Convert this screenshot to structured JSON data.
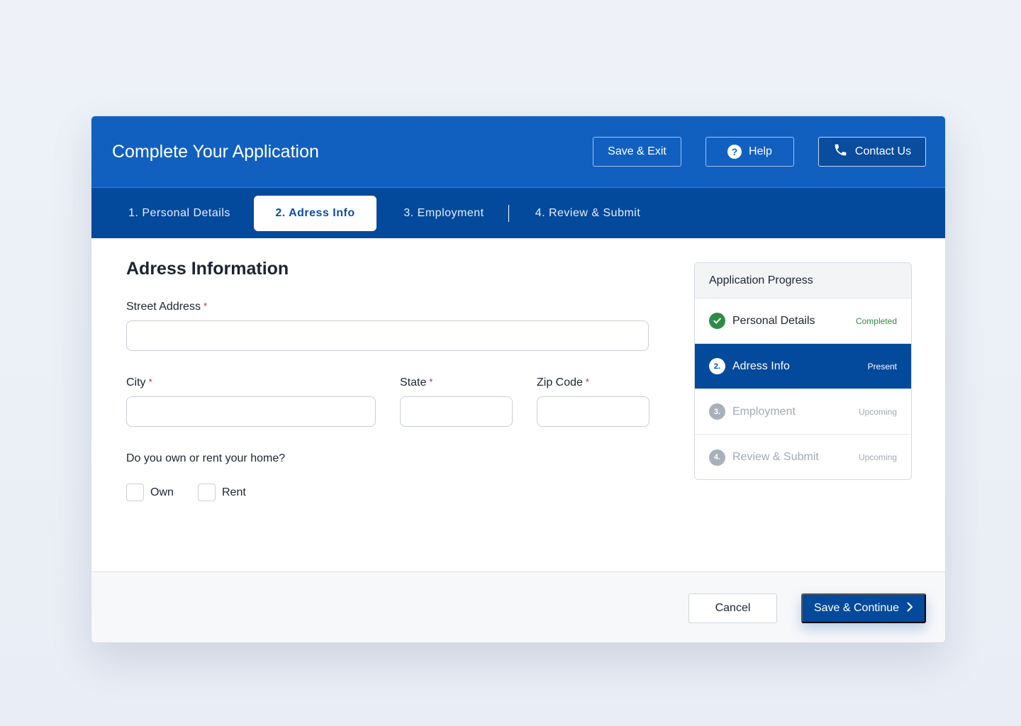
{
  "header": {
    "title": "Complete Your Application",
    "save_exit_label": "Save & Exit",
    "help_label": "Help",
    "help_icon_glyph": "?",
    "contact_label": "Contact Us"
  },
  "tabs": [
    {
      "label": "1. Personal Details",
      "active": false
    },
    {
      "label": "2. Adress Info",
      "active": true
    },
    {
      "label": "3. Employment",
      "active": false
    },
    {
      "label": "4. Review & Submit",
      "active": false
    }
  ],
  "form": {
    "section_title": "Adress Information",
    "required_marker": "*",
    "street": {
      "label": "Street Address",
      "value": "",
      "placeholder": ""
    },
    "city": {
      "label": "City",
      "value": "",
      "placeholder": ""
    },
    "state": {
      "label": "State",
      "value": "",
      "placeholder": ""
    },
    "zip": {
      "label": "Zip Code",
      "value": "",
      "placeholder": ""
    },
    "ownership_question": "Do you own or rent your home?",
    "ownership_options": [
      {
        "label": "Own",
        "checked": false
      },
      {
        "label": "Rent",
        "checked": false
      }
    ]
  },
  "progress": {
    "title": "Application Progress",
    "steps": [
      {
        "badge": "",
        "name": "Personal Details",
        "status": "Completed",
        "state": "done"
      },
      {
        "badge": "2.",
        "name": "Adress Info",
        "status": "Present",
        "state": "active"
      },
      {
        "badge": "3.",
        "name": "Employment",
        "status": "Upcoming",
        "state": "upcoming"
      },
      {
        "badge": "4.",
        "name": "Review & Submit",
        "status": "Upcoming",
        "state": "upcoming"
      }
    ]
  },
  "footer": {
    "cancel_label": "Cancel",
    "continue_label": "Save & Continue"
  },
  "colors": {
    "header_bg": "#1160c0",
    "tabbar_bg": "#044a9c",
    "completed_green": "#2e8b47",
    "required_red": "#d0202a"
  },
  "icons": {
    "help": "question-circle-icon",
    "contact": "phone-icon",
    "completed": "check-circle-icon",
    "continue": "chevron-right-icon"
  }
}
